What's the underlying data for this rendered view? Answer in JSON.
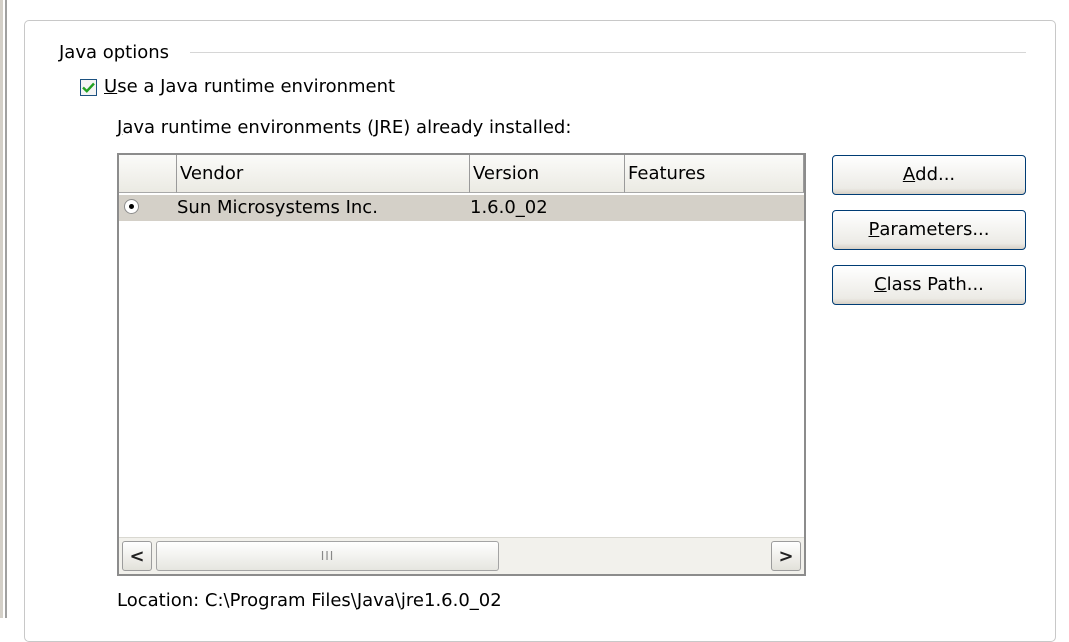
{
  "group": {
    "title": "Java options"
  },
  "use_jre": {
    "checked": true,
    "label_first": "U",
    "label_rest": "se a Java runtime environment"
  },
  "jre_list": {
    "label_first": "J",
    "label_rest": "ava runtime environments (JRE) already installed:",
    "columns": [
      "",
      "Vendor",
      "Version",
      "Features"
    ],
    "rows": [
      {
        "selected": true,
        "vendor": "Sun Microsystems Inc.",
        "version": "1.6.0_02",
        "features": ""
      }
    ],
    "hscroll": {
      "left_arrow": "<",
      "right_arrow": ">",
      "thumb_grip": "III"
    }
  },
  "buttons": {
    "add": {
      "mnemonic": "A",
      "rest": "dd..."
    },
    "parameters": {
      "mnemonic": "P",
      "rest": "arameters..."
    },
    "class_path": {
      "mnemonic": "C",
      "rest": "lass Path..."
    }
  },
  "location": "Location: C:\\Program Files\\Java\\jre1.6.0_02",
  "colors": {
    "selection": "#d4d0c8",
    "check": "#21a121",
    "button_border": "#003c74"
  }
}
